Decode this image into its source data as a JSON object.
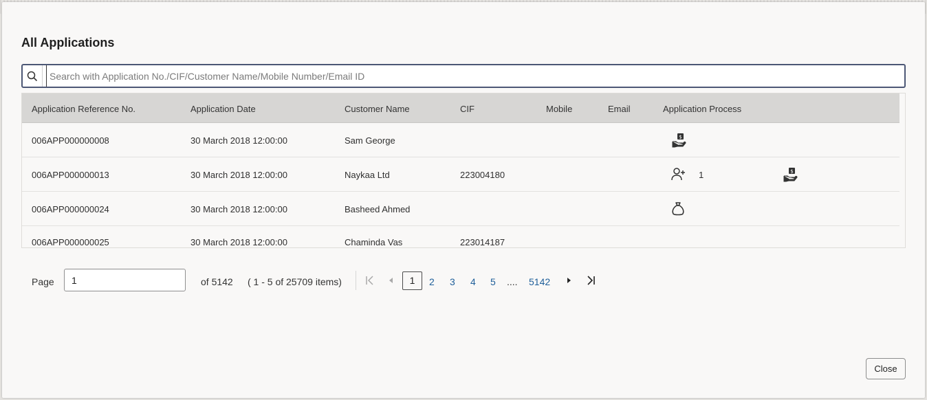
{
  "dialog": {
    "title": "All Applications",
    "close_label": "Close"
  },
  "search": {
    "placeholder": "Search with Application No./CIF/Customer Name/Mobile Number/Email ID",
    "value": ""
  },
  "table": {
    "columns": [
      "Application Reference No.",
      "Application Date",
      "Customer Name",
      "CIF",
      "Mobile",
      "Email",
      "Application Process"
    ],
    "rows": [
      {
        "ref": "006APP000000008",
        "date": "30 March 2018 12:00:00",
        "customer": "Sam George",
        "cif": "",
        "mobile": "",
        "email": "",
        "process_icons": [
          "hand-money-icon"
        ],
        "process_count": ""
      },
      {
        "ref": "006APP000000013",
        "date": "30 March 2018 12:00:00",
        "customer": "Naykaa Ltd",
        "cif": "223004180",
        "mobile": "",
        "email": "",
        "process_icons": [
          "add-user-icon",
          "hand-money-icon"
        ],
        "process_count": "1"
      },
      {
        "ref": "006APP000000024",
        "date": "30 March 2018 12:00:00",
        "customer": "Basheed Ahmed",
        "cif": "",
        "mobile": "",
        "email": "",
        "process_icons": [
          "money-bag-icon"
        ],
        "process_count": ""
      },
      {
        "ref": "006APP000000025",
        "date": "30 March 2018 12:00:00",
        "customer": "Chaminda Vas",
        "cif": "223014187",
        "mobile": "",
        "email": "",
        "process_icons": [],
        "process_count": ""
      }
    ]
  },
  "pagination": {
    "page_label": "Page",
    "current_page": "1",
    "of_text": "of 5142",
    "items_text": "( 1 - 5 of 25709 items)",
    "pages": [
      "1",
      "2",
      "3",
      "4",
      "5"
    ],
    "ellipsis": "....",
    "last_page": "5142"
  },
  "colors": {
    "accent_border": "#4c5775",
    "header_bg": "#d7d6d4",
    "link": "#1f5f9a"
  }
}
